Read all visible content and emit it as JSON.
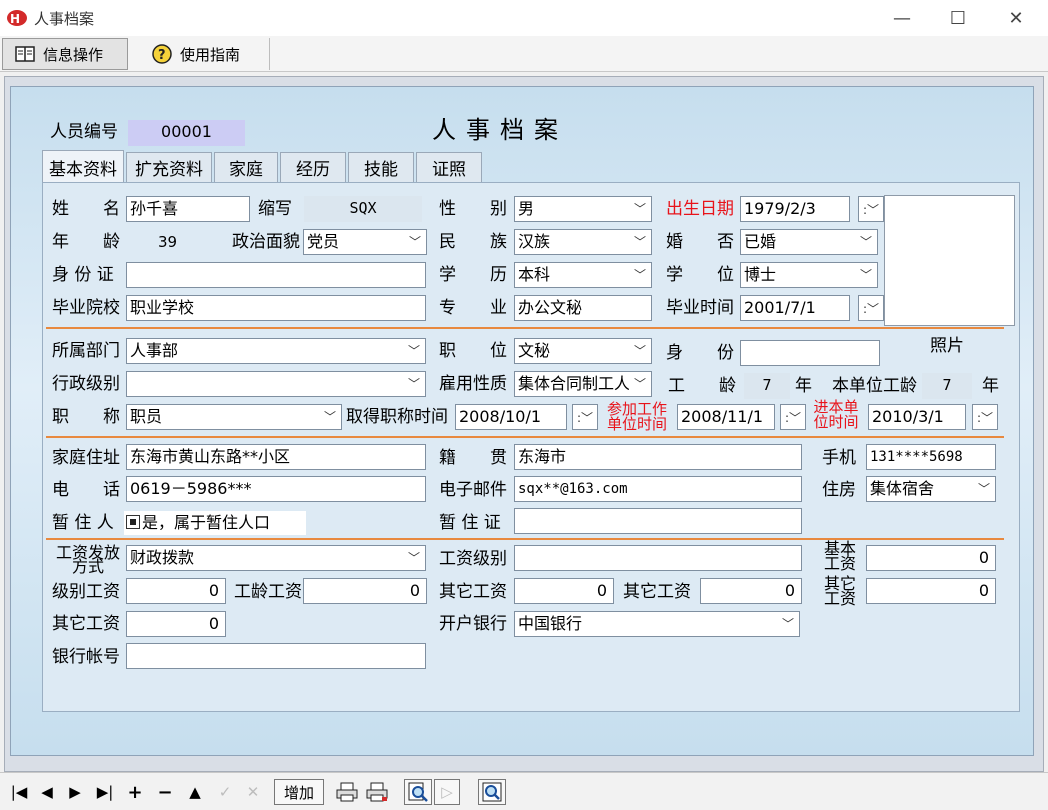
{
  "window": {
    "title": "人事档案",
    "minimize": "—",
    "maximize": "☐",
    "close": "✕"
  },
  "menu": {
    "info_ops": "信息操作",
    "guide": "使用指南"
  },
  "form": {
    "title": "人事档案",
    "staff_no_label": "人员编号",
    "staff_no": "00001",
    "photo_label": "照片"
  },
  "tabs": [
    "基本资料",
    "扩充资料",
    "家庭",
    "经历",
    "技能",
    "证照"
  ],
  "basic": {
    "name_label": "姓　　名",
    "name": "孙千喜",
    "abbr_label": "缩写",
    "abbr": "SQX",
    "sex_label": "性　　别",
    "sex": "男",
    "birth_label": "出生日期",
    "birth": "1979/2/3",
    "age_label": "年　　龄",
    "age": "39",
    "political_label": "政治面貌",
    "political": "党员",
    "ethnic_label": "民　　族",
    "ethnic": "汉族",
    "marital_label": "婚　　否",
    "marital": "已婚",
    "id_label": "身 份 证",
    "id": "",
    "edu_label": "学　　历",
    "edu": "本科",
    "degree_label": "学　　位",
    "degree": "博士",
    "school_label": "毕业院校",
    "school": "职业学校",
    "major_label": "专　　业",
    "major": "办公文秘",
    "grad_label": "毕业时间",
    "grad": "2001/7/1"
  },
  "job": {
    "dept_label": "所属部门",
    "dept": "人事部",
    "post_label": "职　　位",
    "post": "文秘",
    "status_label": "身　　份",
    "status": "",
    "admin_label": "行政级别",
    "admin": "",
    "employ_label": "雇用性质",
    "employ": "集体合同制工人",
    "work_years_label": "工　　龄",
    "work_years": "7",
    "year_unit": "年",
    "unit_years_label": "本单位工龄",
    "unit_years": "7",
    "title_label": "职　　称",
    "title": "职员",
    "title_date_label": "取得职称时间",
    "title_date": "2008/10/1",
    "join_line1": "参加工作",
    "join_line2": "单位时间",
    "join_date": "2008/11/1",
    "enter_line1": "进本单",
    "enter_line2": "位时间",
    "enter_date": "2010/3/1"
  },
  "contact": {
    "address_label": "家庭住址",
    "address": "东海市黄山东路**小区",
    "native_label": "籍　　贯",
    "native": "东海市",
    "mobile_label": "手机",
    "mobile": "131****5698",
    "phone_label": "电　　话",
    "phone": "0619－5986***",
    "email_label": "电子邮件",
    "email": "sqx**@163.com",
    "housing_label": "住房",
    "housing": "集体宿舍",
    "temp_label": "暂 住 人",
    "temp": "是，属于暂住人口",
    "temp_cert_label": "暂 住 证",
    "temp_cert": ""
  },
  "salary": {
    "pay_line1": "工资发放",
    "pay_line2": "方式",
    "pay_method": "财政拨款",
    "grade_label": "工资级别",
    "grade": "",
    "base_line1": "基本",
    "base_line2": "工资",
    "base": "0",
    "level_label": "级别工资",
    "level": "0",
    "seniority_label": "工龄工资",
    "seniority": "0",
    "other1_label": "其它工资",
    "other1": "0",
    "other2_label": "其它工资",
    "other2": "0",
    "other3_line1": "其它",
    "other3_line2": "工资",
    "other3": "0",
    "other4_label": "其它工资",
    "other4": "0",
    "bank_label": "开户银行",
    "bank": "中国银行",
    "account_label": "银行帐号",
    "account": ""
  },
  "toolbar": {
    "add": "增加"
  },
  "colors": {
    "accent_red": "#e8131a",
    "separator": "#e8893f",
    "panel_blue": "#c6deee",
    "id_highlight": "#ccccf4"
  }
}
